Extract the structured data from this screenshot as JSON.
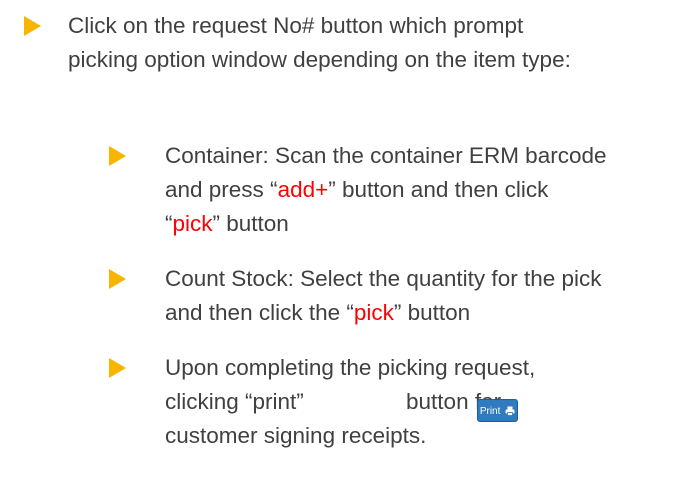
{
  "items": [
    {
      "lines": [
        [
          "Click on the request No# button which prompt"
        ],
        [
          "picking option window depending on the item type:"
        ]
      ]
    },
    {
      "lines": [
        [
          "Container: Scan the container ERM barcode"
        ],
        [
          "and press “",
          "add+",
          "” button and then click"
        ],
        [
          "“",
          "pick",
          "” button"
        ]
      ]
    },
    {
      "lines": [
        [
          "Count Stock: Select the quantity for the pick"
        ],
        [
          "and then click the “",
          "pick",
          "” button"
        ]
      ]
    },
    {
      "lines": [
        [
          "Upon completing the picking request,"
        ],
        [
          "clicking “print”",
          " button for"
        ],
        [
          "customer signing receipts."
        ]
      ]
    }
  ],
  "print_button": {
    "label": "Print",
    "icon": "print-icon"
  },
  "colors": {
    "bullet": "#f7b500",
    "highlight": "#ff0000",
    "text": "#404040",
    "button": "#2f7bbd"
  }
}
